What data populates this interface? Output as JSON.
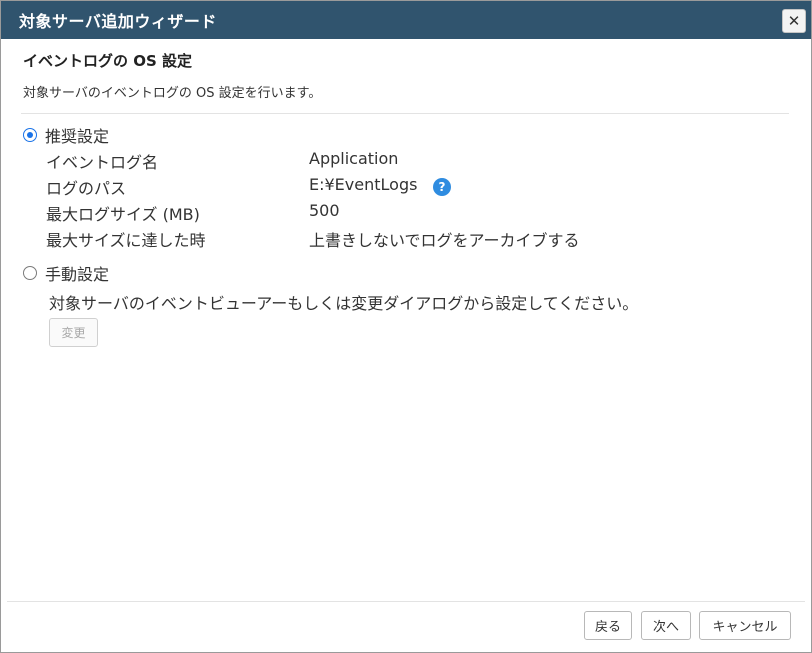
{
  "window": {
    "title": "対象サーバ追加ウィザード",
    "close_glyph": "✕"
  },
  "section": {
    "title": "イベントログの OS 設定",
    "description": "対象サーバのイベントログの OS 設定を行います。"
  },
  "recommended": {
    "label": "推奨設定",
    "selected": true,
    "rows": [
      {
        "label": "イベントログ名",
        "value": "Application"
      },
      {
        "label": "ログのパス",
        "value": "E:¥EventLogs"
      },
      {
        "label": "最大ログサイズ (MB)",
        "value": "500"
      },
      {
        "label": "最大サイズに達した時",
        "value": "上書きしないでログをアーカイブする"
      }
    ],
    "help_icon": "?"
  },
  "manual": {
    "label": "手動設定",
    "selected": false,
    "description": "対象サーバのイベントビューアーもしくは変更ダイアログから設定してください。",
    "change_button": "変更"
  },
  "footer": {
    "back": "戻る",
    "next": "次へ",
    "cancel": "キャンセル"
  },
  "colors": {
    "titlebar": "#30546e",
    "radio_accent": "#1a73e8",
    "help_icon": "#2f8ce0"
  }
}
